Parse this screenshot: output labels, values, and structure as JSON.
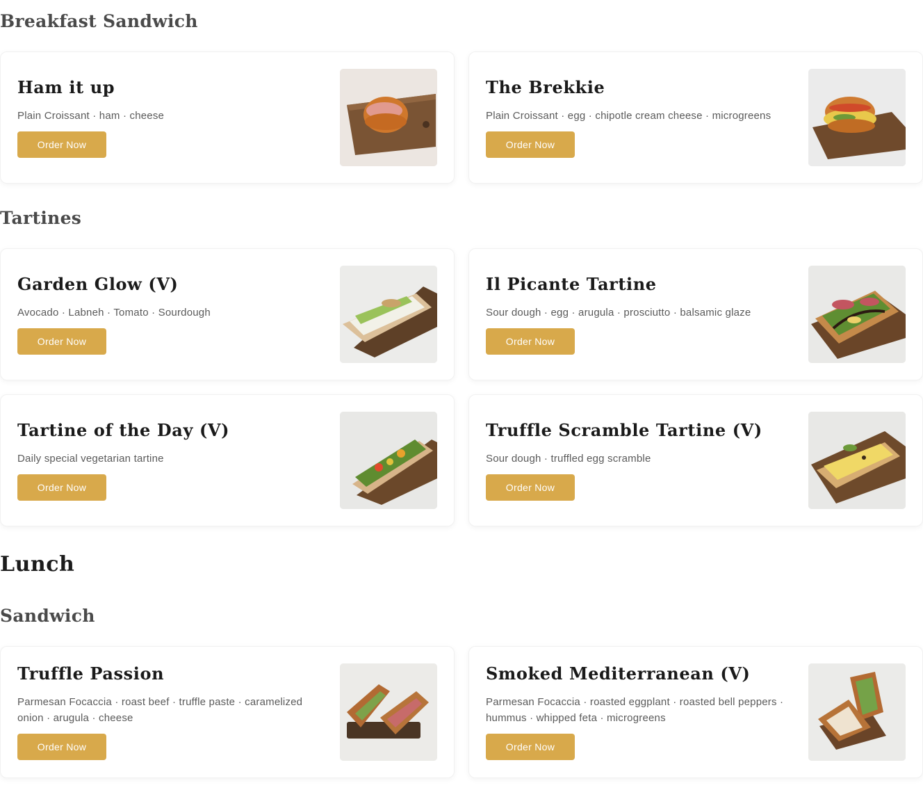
{
  "sections": {
    "breakfast_sandwich": "Breakfast Sandwich",
    "tartines": "Tartines",
    "lunch": "Lunch",
    "sandwich": "Sandwich"
  },
  "items": [
    {
      "name": "Ham it up",
      "description": "Plain Croissant · ham · cheese",
      "button": "Order Now",
      "image": "croissant-ham-photo"
    },
    {
      "name": "The Brekkie",
      "description": "Plain Croissant · egg · chipotle cream cheese · microgreens",
      "button": "Order Now",
      "image": "croissant-egg-photo"
    },
    {
      "name": "Garden Glow (V)",
      "description": "Avocado · Labneh · Tomato · Sourdough",
      "button": "Order Now",
      "image": "avocado-tartine-photo"
    },
    {
      "name": "Il Picante Tartine",
      "description": "Sour dough · egg · arugula · prosciutto · balsamic glaze",
      "button": "Order Now",
      "image": "prosciutto-tartine-photo"
    },
    {
      "name": "Tartine of the Day (V)",
      "description": "Daily special vegetarian tartine",
      "button": "Order Now",
      "image": "vegetable-tartine-photo"
    },
    {
      "name": "Truffle Scramble Tartine (V)",
      "description": "Sour dough · truffled egg scramble",
      "button": "Order Now",
      "image": "egg-scramble-tartine-photo"
    },
    {
      "name": "Truffle Passion",
      "description": "Parmesan Focaccia · roast beef · truffle paste · caramelized onion · arugula · cheese",
      "button": "Order Now",
      "image": "focaccia-sandwich-photo"
    },
    {
      "name": "Smoked Mediterranean (V)",
      "description": "Parmesan Focaccia · roasted eggplant · roasted bell peppers · hummus · whipped feta · microgreens",
      "button": "Order Now",
      "image": "focaccia-veggie-sandwich-photo"
    }
  ]
}
